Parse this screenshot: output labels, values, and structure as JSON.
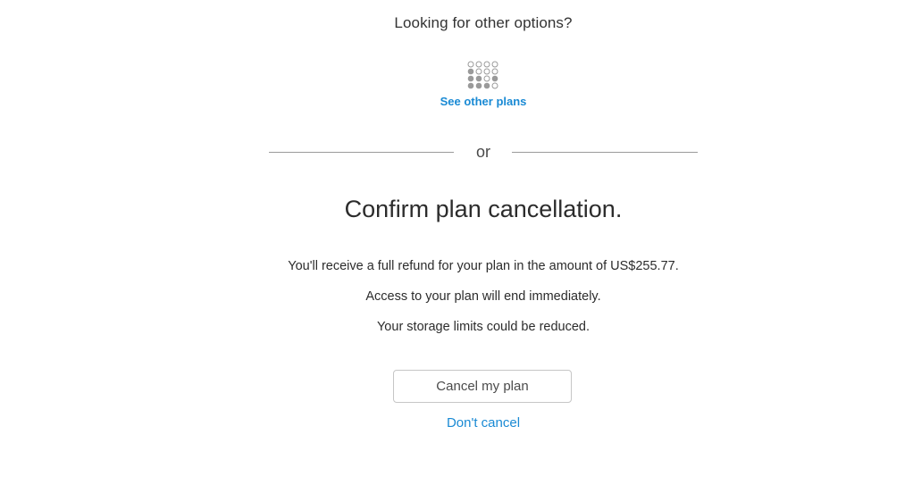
{
  "options": {
    "heading": "Looking for other options?",
    "icon": "plans-grid-icon",
    "link_label": "See other plans"
  },
  "divider": {
    "label": "or"
  },
  "confirm": {
    "title": "Confirm plan cancellation.",
    "refund_text": "You'll receive a full refund for your plan in the amount of US$255.77.",
    "access_text": "Access to your plan will end immediately.",
    "storage_text": "Your storage limits could be reduced."
  },
  "actions": {
    "cancel_button": "Cancel my plan",
    "dont_cancel_link": "Don't cancel"
  },
  "colors": {
    "link": "#1a8ad4",
    "text": "#2c2c2c",
    "divider": "#9a9a9a"
  }
}
